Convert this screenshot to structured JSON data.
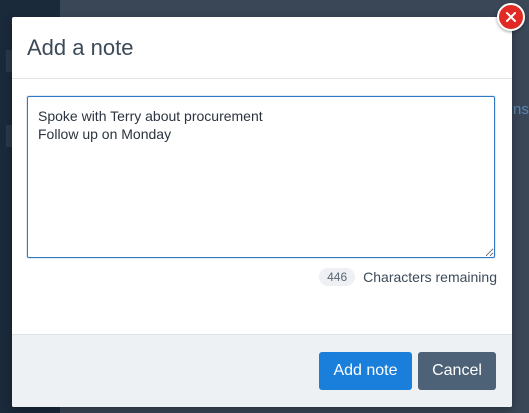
{
  "modal": {
    "title": "Add a note",
    "note_text": "Spoke with Terry about procurement\nFollow up on Monday",
    "characters_remaining_count": "446",
    "characters_remaining_label": "Characters remaining",
    "add_note_label": "Add note",
    "cancel_label": "Cancel",
    "close_icon": "close-icon"
  },
  "background": {
    "partial_text": "ns"
  },
  "colors": {
    "primary_button": "#1a7fdb",
    "secondary_button": "#4d6177",
    "close_button": "#e02a23",
    "focus_border": "#2f78c4"
  }
}
